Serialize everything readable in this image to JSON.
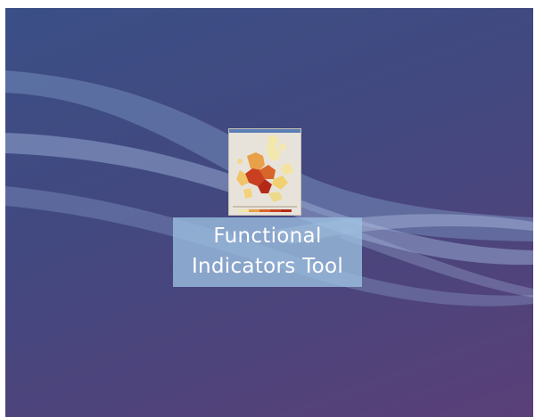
{
  "desktop": {
    "icon": {
      "name": "Functional Indicators Tool",
      "label_lines": [
        "Functional",
        "Indicators Tool"
      ],
      "thumbnail": "europe-choropleth-map-icon"
    }
  },
  "colors": {
    "wallpaper_start": "#3a4f86",
    "wallpaper_end": "#5a3f78",
    "label_highlight": "#9cc0e0"
  }
}
